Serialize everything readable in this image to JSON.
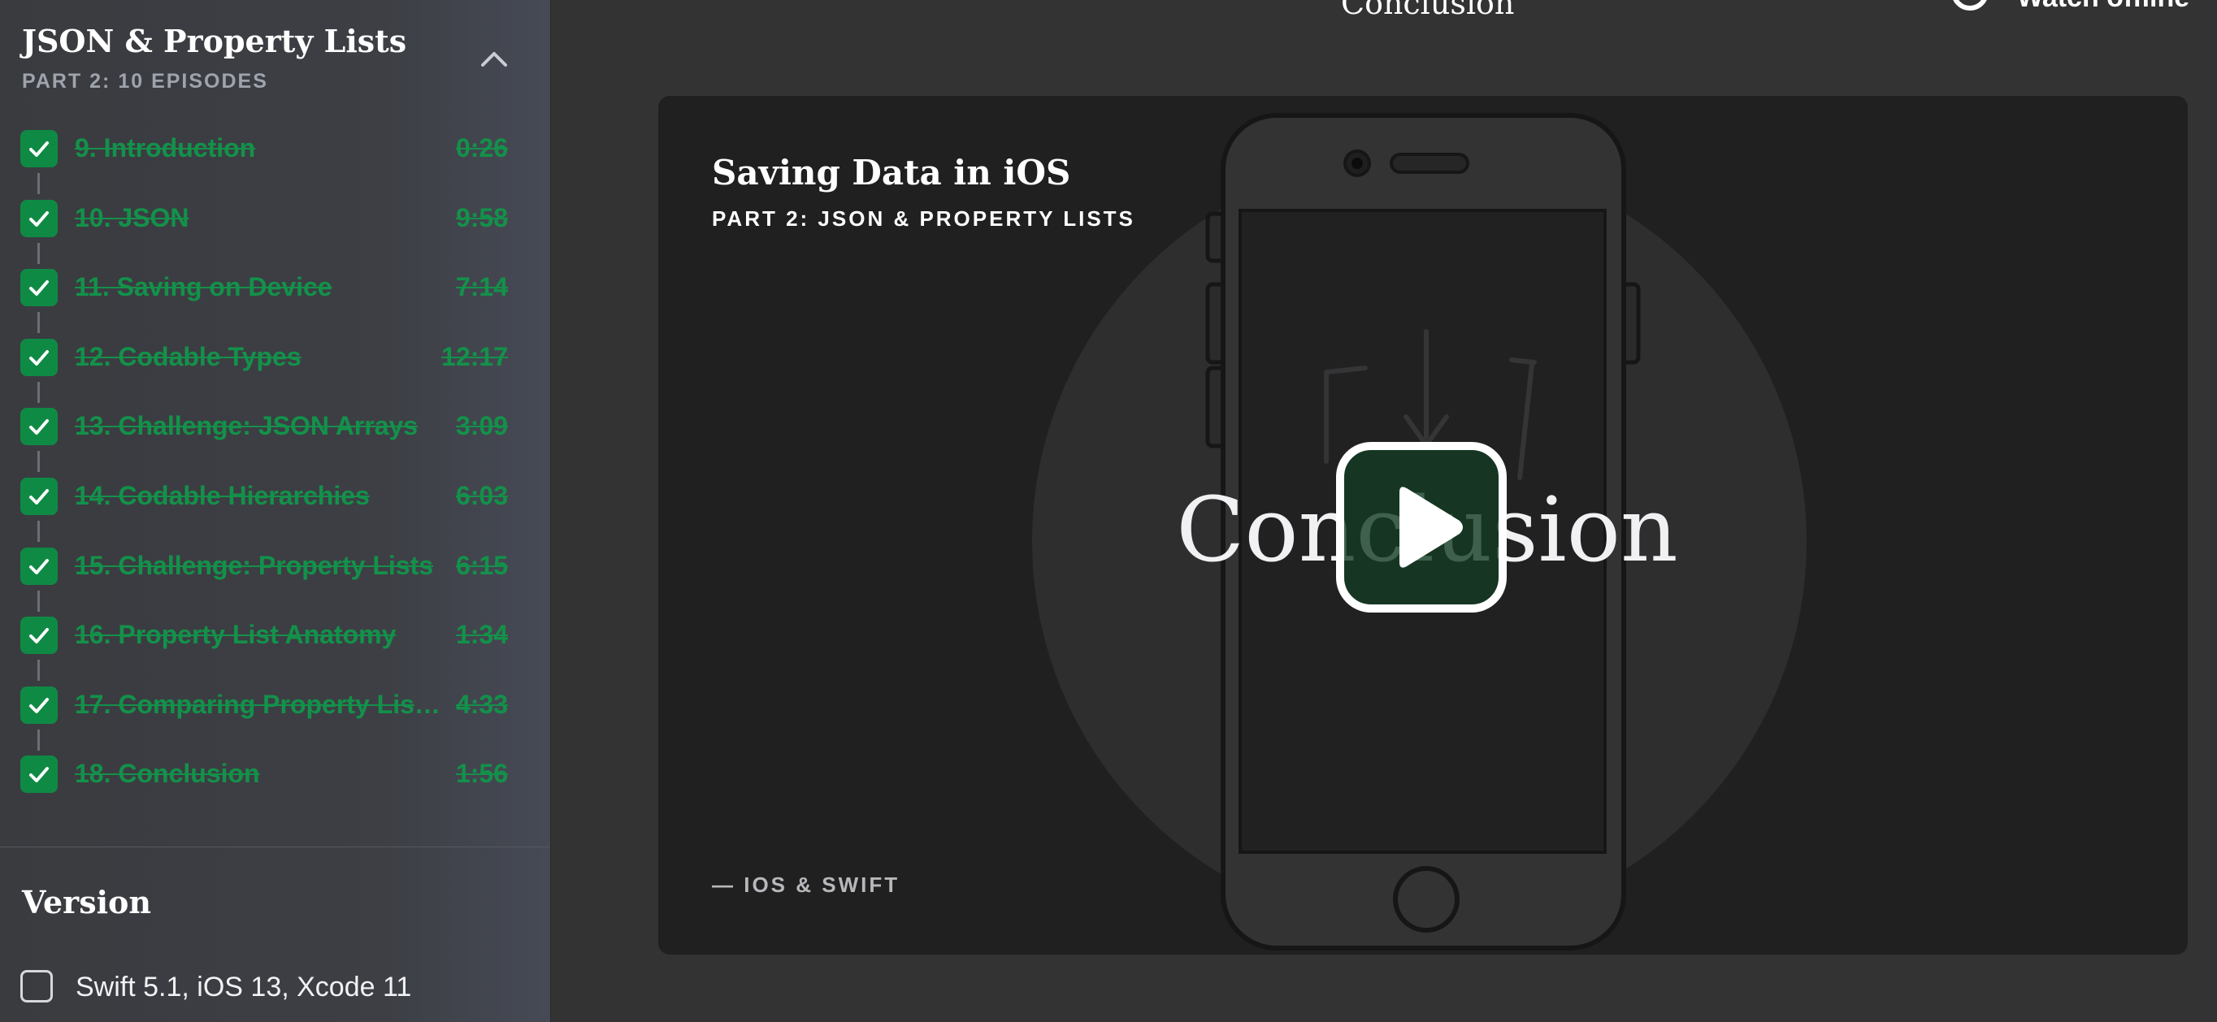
{
  "sidebar": {
    "title": "JSON & Property Lists",
    "subtitle": "PART 2: 10 EPISODES",
    "collapse_icon": "chevron-up-icon",
    "episodes": [
      {
        "title": "9. Introduction",
        "time": "0:26"
      },
      {
        "title": "10. JSON",
        "time": "9:58"
      },
      {
        "title": "11. Saving on Device",
        "time": "7:14"
      },
      {
        "title": "12. Codable Types",
        "time": "12:17"
      },
      {
        "title": "13. Challenge: JSON Arrays",
        "time": "3:09"
      },
      {
        "title": "14. Codable Hierarchies",
        "time": "6:03"
      },
      {
        "title": "15. Challenge: Property Lists",
        "time": "6:15"
      },
      {
        "title": "16. Property List Anatomy",
        "time": "1:34"
      },
      {
        "title": "17. Comparing Property List…",
        "time": "4:33"
      },
      {
        "title": "18. Conclusion",
        "time": "1:56"
      }
    ],
    "version": {
      "heading": "Version",
      "option": "Swift 5.1, iOS 13, Xcode 11"
    }
  },
  "header": {
    "title": "Conclusion",
    "watch_offline": "Watch offline"
  },
  "player": {
    "course_title": "Saving Data in iOS",
    "part_label": "PART 2: JSON & PROPERTY LISTS",
    "episode_title": "Conclusion",
    "footer": "— IOS & SWIFT",
    "play_icon": "play-icon"
  },
  "colors": {
    "accent_green": "#13914a",
    "check_bg": "#0f8a45",
    "background": "#333334",
    "player_bg": "#202021"
  }
}
